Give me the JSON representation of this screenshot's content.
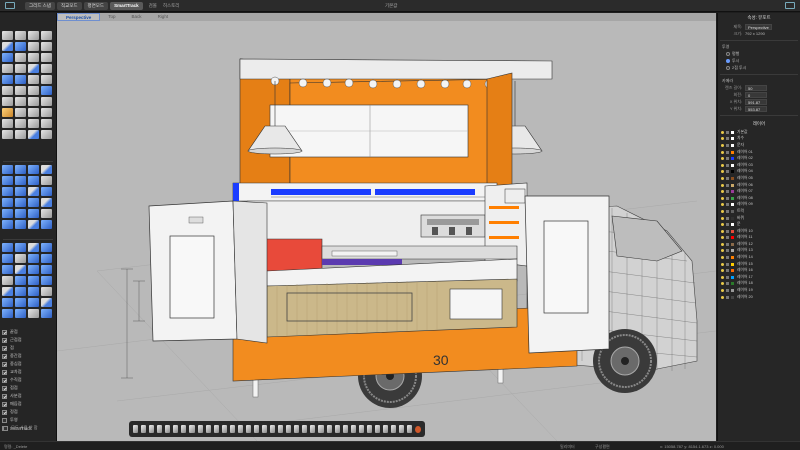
{
  "topbar": {
    "pills": [
      "그리드 스냅",
      "직교모드",
      "평면모드",
      "SmartTrack"
    ],
    "active_pill": 3,
    "extra_left": "검볼",
    "extra_left2": "히스토리",
    "center_title": "기본값"
  },
  "viewport": {
    "tabs": [
      "Perspective",
      "Top",
      "Back",
      "Right"
    ],
    "active_tab": 0,
    "truck_number": "30"
  },
  "left_panel": {
    "layers": [
      {
        "label": "끝점",
        "on": true
      },
      {
        "label": "근접점",
        "on": true
      },
      {
        "label": "점",
        "on": true
      },
      {
        "label": "중간점",
        "on": true
      },
      {
        "label": "중심점",
        "on": true
      },
      {
        "label": "교차점",
        "on": true
      },
      {
        "label": "수직점",
        "on": true
      },
      {
        "label": "접점",
        "on": true
      },
      {
        "label": "사분점",
        "on": true
      },
      {
        "label": "매듭점",
        "on": true
      },
      {
        "label": "정점",
        "on": true
      },
      {
        "label": "투영",
        "on": false
      },
      {
        "label": "SmartTrack",
        "on": false
      }
    ],
    "footer_label": "모두 사용 안 함"
  },
  "right_panel": {
    "title": "속성: 뷰포트",
    "viewport_label": "제목:",
    "viewport_value": "Perspective",
    "size_label": "크기:",
    "size_value": "792 x 1290",
    "projection_section": "투영",
    "projection_options": [
      {
        "label": "평행",
        "on": false
      },
      {
        "label": "투시",
        "on": true
      },
      {
        "label": "2점 투시",
        "on": false
      }
    ],
    "camera_section": "카메라",
    "camera_rows": [
      {
        "label": "렌즈 길이:",
        "value": "50"
      },
      {
        "label": "회전:",
        "value": "0"
      },
      {
        "label": "X 위치:",
        "value": "591.87"
      },
      {
        "label": "Y 위치:",
        "value": "553.87"
      }
    ],
    "layers_title": "레이어",
    "layers": [
      {
        "name": "기본값",
        "color": "#ffffff"
      },
      {
        "name": "치수",
        "color": "#ffffff"
      },
      {
        "name": "문자",
        "color": "#ffffff"
      },
      {
        "name": "레이어 01",
        "color": "#ff7f00"
      },
      {
        "name": "레이어 02",
        "color": "#1a3cff"
      },
      {
        "name": "레이어 03",
        "color": "#ffffff"
      },
      {
        "name": "레이어 04",
        "color": "#000000"
      },
      {
        "name": "레이어 05",
        "color": "#8a4e1f"
      },
      {
        "name": "레이어 06",
        "color": "#c8a86a"
      },
      {
        "name": "레이어 07",
        "color": "#9b3b9b"
      },
      {
        "name": "레이어 08",
        "color": "#3aa24a"
      },
      {
        "name": "레이어 09",
        "color": "#ffffff"
      },
      {
        "name": "트럭",
        "color": "#606060"
      },
      {
        "name": "바퀴",
        "color": "#303030"
      },
      {
        "name": "문",
        "color": "#ffffff"
      },
      {
        "name": "레이어 10",
        "color": "#e84a3a"
      },
      {
        "name": "레이어 11",
        "color": "#ff0000"
      },
      {
        "name": "레이어 12",
        "color": "#8a6a4a"
      },
      {
        "name": "레이어 13",
        "color": "#aaaaaa"
      },
      {
        "name": "레이어 14",
        "color": "#ff7f00"
      },
      {
        "name": "레이어 15",
        "color": "#ffcc00"
      },
      {
        "name": "레이어 16",
        "color": "#ff6a00"
      },
      {
        "name": "레이어 17",
        "color": "#00a0ff"
      },
      {
        "name": "레이어 18",
        "color": "#2a7a2a"
      },
      {
        "name": "레이어 19",
        "color": "#999999"
      },
      {
        "name": "레이어 20",
        "color": "#444444"
      }
    ]
  },
  "status": {
    "command": "명령: _Delete",
    "units": "밀리미터",
    "cplane": "구성평면",
    "coords": "x: 15058.787   y: 8154.1.673   z: 0.000"
  },
  "colors": {
    "truck_orange": "#f28c1f",
    "truck_blue": "#1a3cff",
    "truck_white": "#f3f3f3",
    "wheel": "#333333"
  }
}
